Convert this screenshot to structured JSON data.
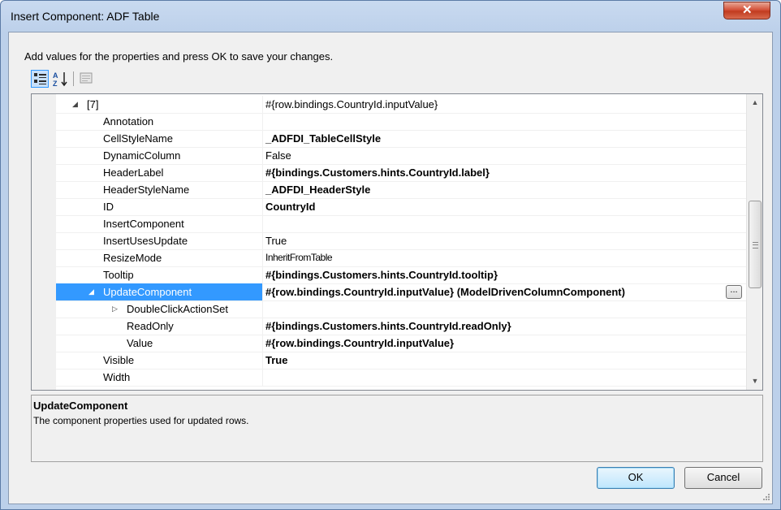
{
  "window": {
    "title": "Insert Component: ADF Table"
  },
  "instructions": "Add values for the properties and press OK to save your changes.",
  "toolbar": {
    "categorized_icon": "categorized-view-icon",
    "alphabetical_icon": "sort-alphabetical-icon",
    "property_pages_icon": "property-pages-icon"
  },
  "grid": {
    "rows": [
      {
        "name": "[7]",
        "value": "#{row.bindings.CountryId.inputValue}",
        "bold": false,
        "level": 0,
        "expander": "expanded"
      },
      {
        "name": "Annotation",
        "value": "",
        "bold": false,
        "level": 1
      },
      {
        "name": "CellStyleName",
        "value": "_ADFDI_TableCellStyle",
        "bold": true,
        "level": 1
      },
      {
        "name": "DynamicColumn",
        "value": "False",
        "bold": false,
        "level": 1
      },
      {
        "name": "HeaderLabel",
        "value": "#{bindings.Customers.hints.CountryId.label}",
        "bold": true,
        "level": 1
      },
      {
        "name": "HeaderStyleName",
        "value": "_ADFDI_HeaderStyle",
        "bold": true,
        "level": 1
      },
      {
        "name": "ID",
        "value": "CountryId",
        "bold": true,
        "level": 1
      },
      {
        "name": "InsertComponent",
        "value": "",
        "bold": false,
        "level": 1
      },
      {
        "name": "InsertUsesUpdate",
        "value": "True",
        "bold": false,
        "level": 1
      },
      {
        "name": "ResizeMode",
        "value": "InheritFromTable",
        "bold": false,
        "level": 1
      },
      {
        "name": "Tooltip",
        "value": "#{bindings.Customers.hints.CountryId.tooltip}",
        "bold": true,
        "level": 1
      },
      {
        "name": "UpdateComponent",
        "value": "#{row.bindings.CountryId.inputValue} (ModelDrivenColumnComponent)",
        "bold": true,
        "level": 1,
        "expander": "expanded",
        "selected": true,
        "ellipsis": "..."
      },
      {
        "name": "DoubleClickActionSet",
        "value": "",
        "bold": false,
        "level": 2,
        "expander": "collapsed"
      },
      {
        "name": "ReadOnly",
        "value": "#{bindings.Customers.hints.CountryId.readOnly}",
        "bold": true,
        "level": 2
      },
      {
        "name": "Value",
        "value": "#{row.bindings.CountryId.inputValue}",
        "bold": true,
        "level": 2
      },
      {
        "name": "Visible",
        "value": "True",
        "bold": true,
        "level": 1
      },
      {
        "name": "Width",
        "value": "",
        "bold": false,
        "level": 1
      }
    ]
  },
  "description": {
    "title": "UpdateComponent",
    "text": "The component properties used for updated rows."
  },
  "buttons": {
    "ok": "OK",
    "cancel": "Cancel"
  },
  "colors": {
    "selection": "#3399ff",
    "close_button": "#c13b1f"
  }
}
